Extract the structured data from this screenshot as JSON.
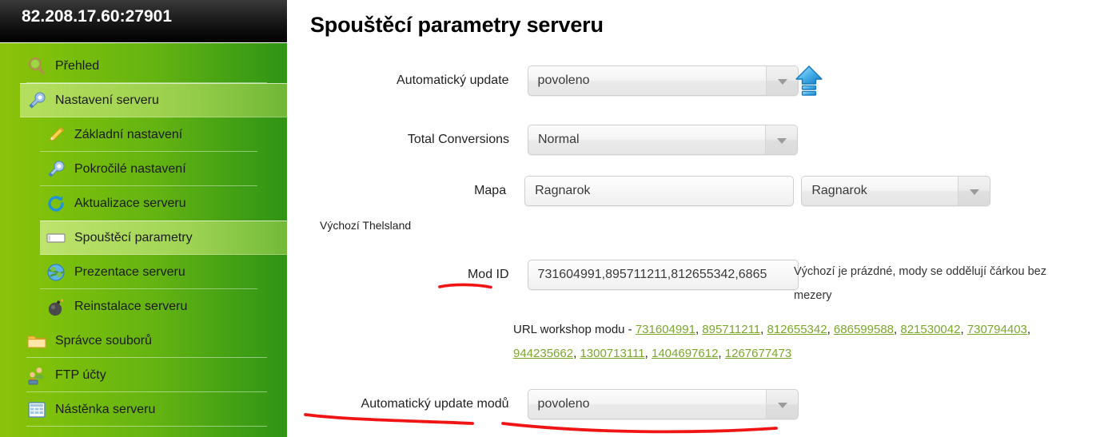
{
  "sidebar": {
    "server_address": "82.208.17.60:27901",
    "items": [
      {
        "label": "Přehled",
        "icon": "magnifier-icon",
        "level": 1,
        "active": false
      },
      {
        "label": "Nastavení serveru",
        "icon": "wrench-icon",
        "level": 1,
        "active": true
      },
      {
        "label": "Základní nastavení",
        "icon": "pencil-icon",
        "level": 2,
        "active": false
      },
      {
        "label": "Pokročilé nastavení",
        "icon": "screwdriver-icon",
        "level": 2,
        "active": false
      },
      {
        "label": "Aktualizace serveru",
        "icon": "refresh-icon",
        "level": 2,
        "active": false
      },
      {
        "label": "Spouštěcí parametry",
        "icon": "console-icon",
        "level": 2,
        "active": true
      },
      {
        "label": "Prezentace serveru",
        "icon": "globe-icon",
        "level": 2,
        "active": false
      },
      {
        "label": "Reinstalace serveru",
        "icon": "bomb-icon",
        "level": 2,
        "active": false
      },
      {
        "label": "Správce souborů",
        "icon": "folder-icon",
        "level": 1,
        "active": false
      },
      {
        "label": "FTP účty",
        "icon": "users-icon",
        "level": 1,
        "active": false
      },
      {
        "label": "Nástěnka serveru",
        "icon": "grid-icon",
        "level": 1,
        "active": false
      }
    ]
  },
  "main": {
    "title": "Spouštěcí parametry serveru",
    "fields": {
      "auto_update": {
        "label": "Automatický update",
        "value": "povoleno",
        "icon": "blue-up-arrow-icon"
      },
      "total_conversions": {
        "label": "Total Conversions",
        "value": "Normal"
      },
      "map": {
        "label": "Mapa",
        "value": "Ragnarok",
        "select_value": "Ragnarok",
        "note": "Výchozí Thelsland"
      },
      "mod_id": {
        "label": "Mod ID",
        "value": "731604991,895711211,812655342,6865",
        "hint": "Výchozí je prázdné, mody se oddělují čárkou bez mezery"
      },
      "auto_update_mods": {
        "label": "Automatický update modů",
        "value": "povoleno"
      }
    },
    "workshop": {
      "prefix": "URL workshop modu -",
      "links": [
        "731604991",
        "895711211",
        "812655342",
        "686599588",
        "821530042",
        "730794403",
        "944235662",
        "1300713111",
        "1404697612",
        "1267677473"
      ],
      "link_color": "#7aa82b"
    }
  },
  "colors": {
    "sidebar_green_light": "#8cc10a",
    "sidebar_green_dark": "#2f9314",
    "header_black": "#000000",
    "annotation_red": "#f01414",
    "link_green": "#7aa82b",
    "accent_blue": "#1e9ae0"
  }
}
